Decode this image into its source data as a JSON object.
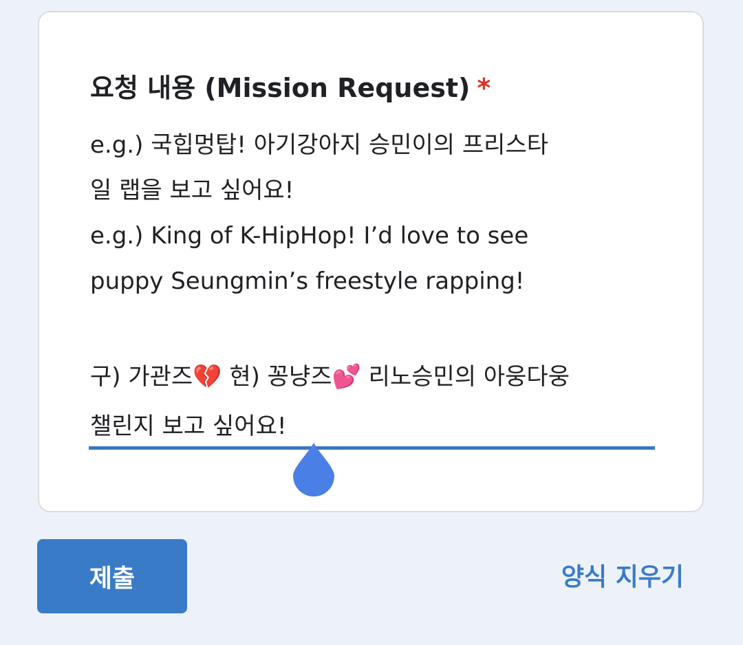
{
  "question": {
    "title": "요청 내용 (Mission Request)",
    "required_marker": "*",
    "description_lines": [
      "e.g.) 국힙멍탑! 아기강아지 승민이의 프리스타",
      "일 랩을 보고 싶어요!",
      "e.g.) King of K-HipHop! I’d love to see",
      "puppy Seungmin’s freestyle rapping!"
    ],
    "answer_lines": [
      "구) 가관즈💔 현) 꽁냥즈💕 리노승민의 아웅다웅",
      "챌린지 보고 싶어요!"
    ]
  },
  "actions": {
    "submit_label": "제출",
    "clear_label": "양식 지우기"
  },
  "colors": {
    "accent": "#3a7bc8",
    "required": "#d93025",
    "handle": "#4a7fe6"
  }
}
